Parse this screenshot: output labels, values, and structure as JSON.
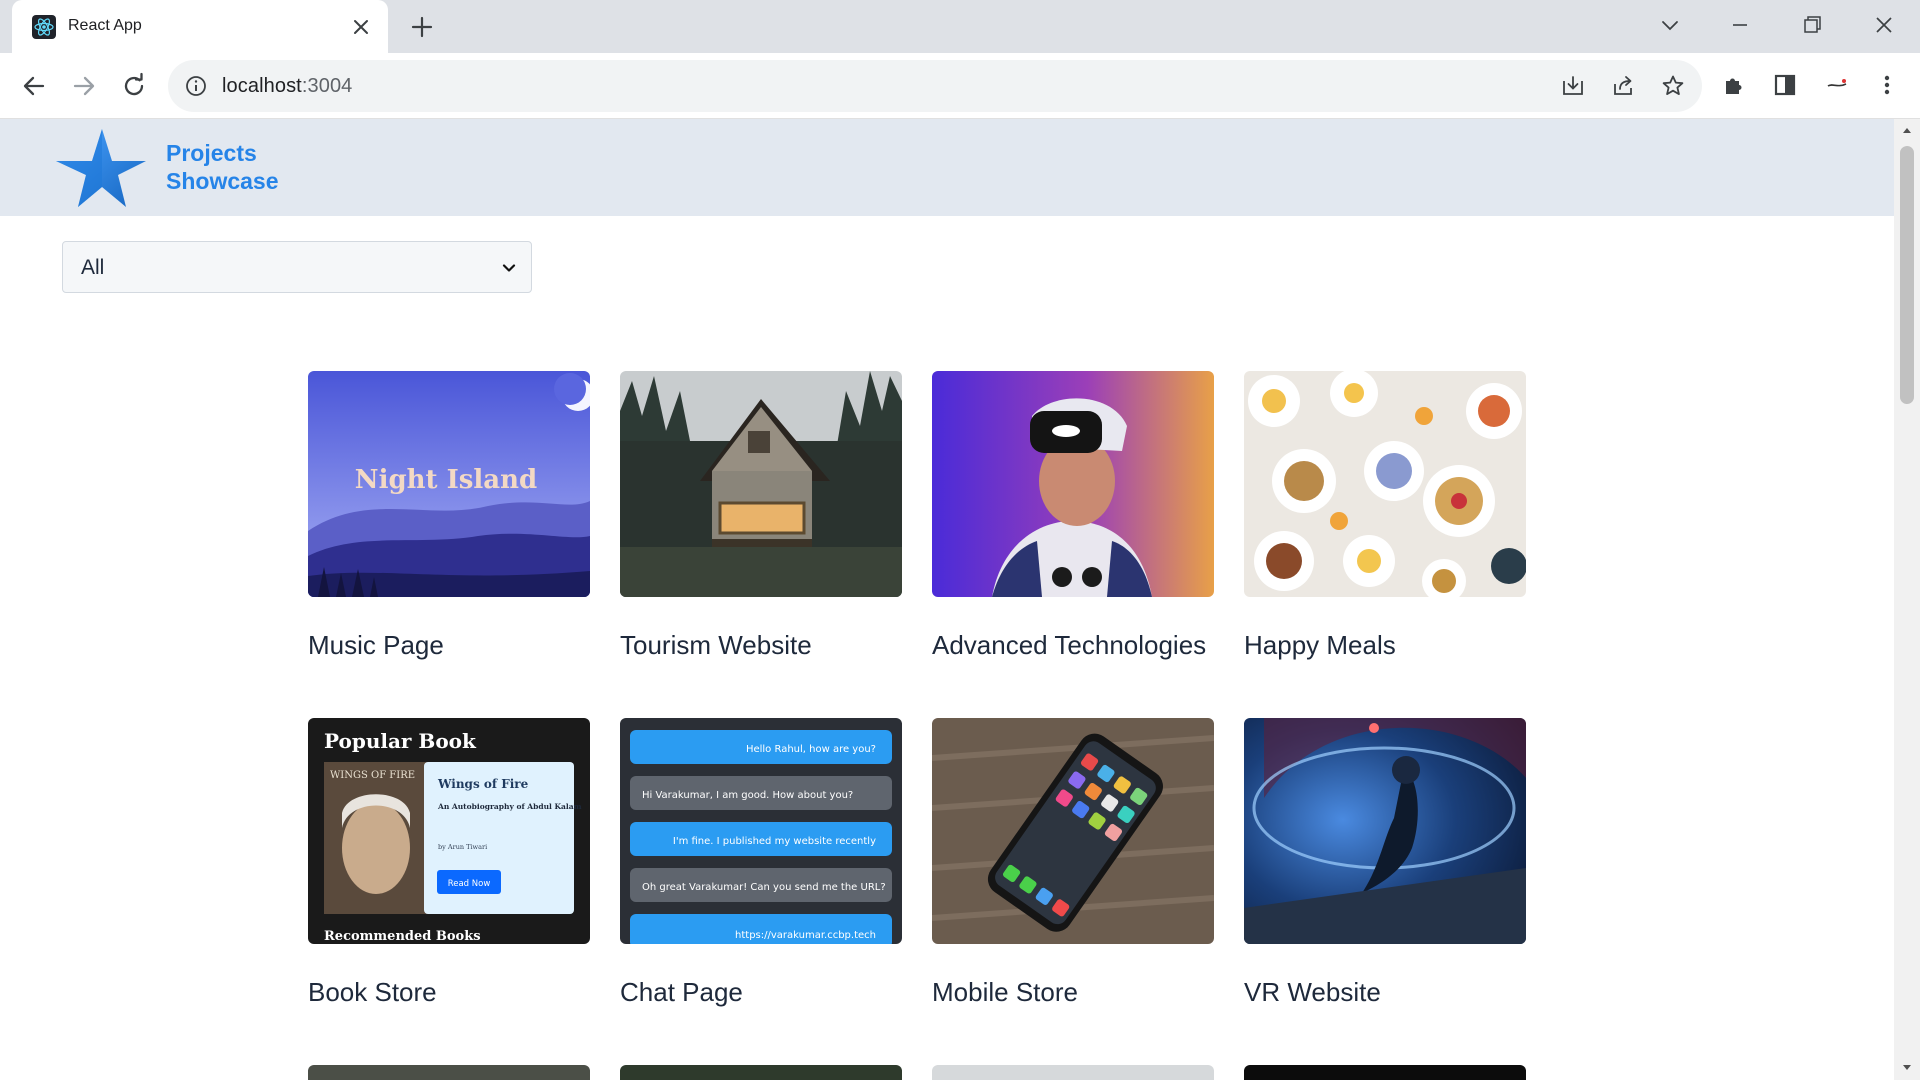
{
  "browser": {
    "tab_title": "React App",
    "url_host": "localhost",
    "url_port": ":3004"
  },
  "site": {
    "brand_line1": "Projects",
    "brand_line2": "Showcase"
  },
  "filter": {
    "selected": "All"
  },
  "projects": [
    {
      "title": "Music Page",
      "thumb_text": "Night Island"
    },
    {
      "title": "Tourism Website"
    },
    {
      "title": "Advanced Technologies"
    },
    {
      "title": "Happy Meals"
    },
    {
      "title": "Book Store",
      "thumb_heading": "Popular Book",
      "book_cover": "WINGS OF FIRE",
      "book_title": "Wings of Fire",
      "book_sub": "An Autobiography of Abdul Kalam",
      "book_author": "by Arun Tiwari",
      "book_button": "Read Now",
      "book_footer": "Recommended Books"
    },
    {
      "title": "Chat Page",
      "chat": [
        "Hello Rahul, how are you?",
        "Hi Varakumar, I am good. How about you?",
        "I'm fine. I published my website recently",
        "Oh great Varakumar! Can you send me the URL?",
        "https://varakumar.ccbp.tech"
      ]
    },
    {
      "title": "Mobile Store"
    },
    {
      "title": "VR Website"
    }
  ]
}
